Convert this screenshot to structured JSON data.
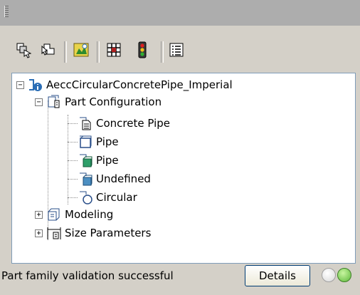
{
  "toolbar": {
    "buttons": [
      {
        "icon": "select-part-icon"
      },
      {
        "icon": "select-parameter-icon"
      },
      {
        "icon": "insert-part-icon"
      },
      {
        "icon": "validate-traffic-light-icon"
      },
      {
        "icon": "list-view-icon"
      }
    ]
  },
  "tree": {
    "root": {
      "label": "AeccCircularConcretePipe_Imperial",
      "expanded": true
    },
    "part_configuration": {
      "label": "Part Configuration",
      "expanded": true
    },
    "children": [
      {
        "label": "Concrete Pipe",
        "icon": "document-icon"
      },
      {
        "label": "Pipe",
        "icon": "pipe-domain-icon"
      },
      {
        "label": "Pipe",
        "icon": "pipe-subtype-icon"
      },
      {
        "label": "Undefined",
        "icon": "undefined-icon"
      },
      {
        "label": "Circular",
        "icon": "circular-shape-icon"
      }
    ],
    "modeling": {
      "label": "Modeling",
      "expanded": false
    },
    "size_parameters": {
      "label": "Size Parameters",
      "expanded": false
    },
    "expander_collapsed": "+",
    "expander_expanded": "−"
  },
  "status": {
    "text": "Part family validation successful",
    "details_label": "Details",
    "led_colors": {
      "off": "#d8d8d8",
      "on": "#5cb83a"
    }
  }
}
